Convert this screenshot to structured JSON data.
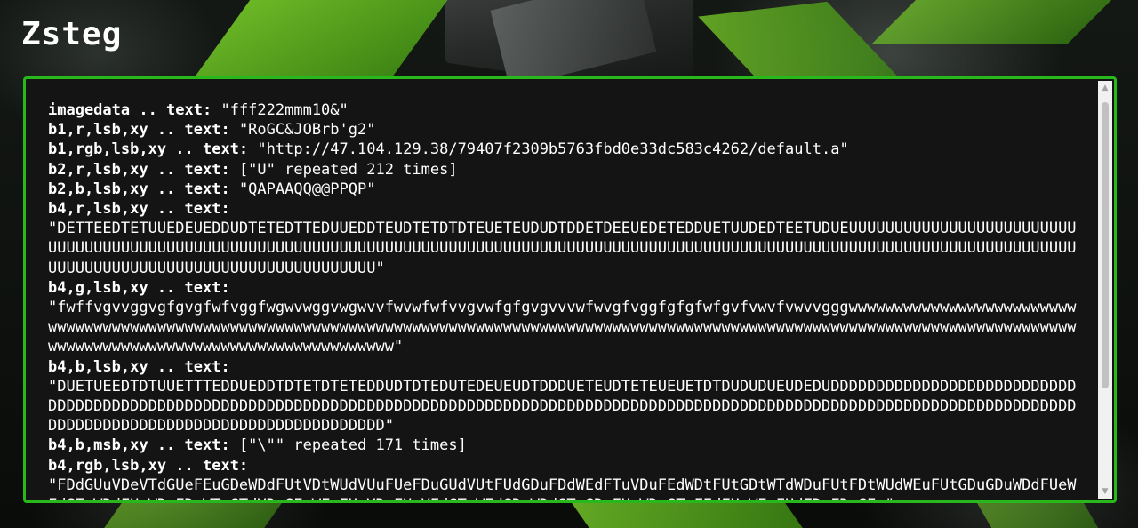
{
  "page": {
    "title": "Zsteg"
  },
  "output": {
    "entries": [
      {
        "key": "imagedata .. text:",
        "value": " \"fff222mmm10&\""
      },
      {
        "key": "b1,r,lsb,xy .. text:",
        "value": " \"RoGC&JOBrb'g2\""
      },
      {
        "key": "b1,rgb,lsb,xy .. text:",
        "value": " \"http://47.104.129.38/79407f2309b5763fbd0e33dc583c4262/default.a\""
      },
      {
        "key": "b2,r,lsb,xy .. text:",
        "value": " [\"U\" repeated 212 times]"
      },
      {
        "key": "b2,b,lsb,xy .. text:",
        "value": " \"QAPAAQQ@@PPQP\""
      },
      {
        "key": "b4,r,lsb,xy .. text:",
        "value": "\n\"DETTEEDTETUUEDEUEDDUDTETEDTTEDUUEDDTEUDTETDTDTEUETEUDUDTDDETDEEUEDETEDDUETUUDEDTEETUDUEUUUUUUUUUUUUUUUUUUUUUUUUUUUUUUUUUUUUUUUUUUUUUUUUUUUUUUUUUUUUUUUUUUUUUUUUUUUUUUUUUUUUUUUUUUUUUUUUUUUUUUUUUUUUUUUUUUUUUUUUUUUUUUUUUUUUUUUUUUUUUUUUUUUUUUUUUUUUUUUUUUUUUUUUUUUUUU\""
      },
      {
        "key": "b4,g,lsb,xy .. text:",
        "value": "\n\"fwffvgvvggvgfgvgfwfvggfwgwvwggvwgwvvfwvwfwfvvgvwfgfgvgvvvwfwvgfvggfgfgfwfgvfvwvfvwvvgggwwwwwwwwwwwwwwwwwwwwwwwwwwwwwwwwwwwwwwwwwwwwwwwwwwwwwwwwwwwwwwwwwwwwwwwwwwwwwwwwwwwwwwwwwwwwwwwwwwwwwwwwwwwwwwwwwwwwwwwwwwwwwwwwwwwwwwwwwwwwwwwwwwwwwwwwwwwwwwwwwwwwwwwwwwwwwwww\""
      },
      {
        "key": "b4,b,lsb,xy .. text:",
        "value": "\n\"DUETUEEDTDTUUETTTEDDUEDDTDTETDTETEDDUDTDTEDUTEDEUEUDTDDDUETEUDTETEUEUETDTDUDUDUEUDEDUDDDDDDDDDDDDDDDDDDDDDDDDDDDDDDDDDDDDDDDDDDDDDDDDDDDDDDDDDDDDDDDDDDDDDDDDDDDDDDDDDDDDDDDDDDDDDDDDDDDDDDDDDDDDDDDDDDDDDDDDDDDDDDDDDDDDDDDDDDDDDDDDDDDDDDDDDDDDDDDDDDDDDDDDDDDDDDDDD\""
      },
      {
        "key": "b4,b,msb,xy .. text:",
        "value": " [\"\\\"\" repeated 171 times]"
      },
      {
        "key": "b4,rgb,lsb,xy .. text:",
        "value": "\n\"FDdGUuVDeVTdGUeFEuGDeWDdFUtVDtWUdVUuFUeFDuGUdVUtFUdGDuFDdWEdFTuVDuFEdWDtFUtGDtWTdWDuFUtFDtWUdWEuFUtGDuGDuWDdFUeWFdGTuWDdFUeWDeFDuWTeGTdVDeGEuWFeFUeVDeFUeVEdGTeWEdGDeWDdGTeGDeFUeWDeGTeFEdFUeWEeFUdFDeFDeGEe\""
      }
    ]
  },
  "scrollbar": {
    "up_icon": "triangle-up-icon",
    "down_icon": "triangle-down-icon",
    "up_glyph": "▲",
    "down_glyph": "▼"
  },
  "colors": {
    "panel_border": "#28b81c",
    "panel_background": "#141414",
    "text": "#ffffff"
  }
}
